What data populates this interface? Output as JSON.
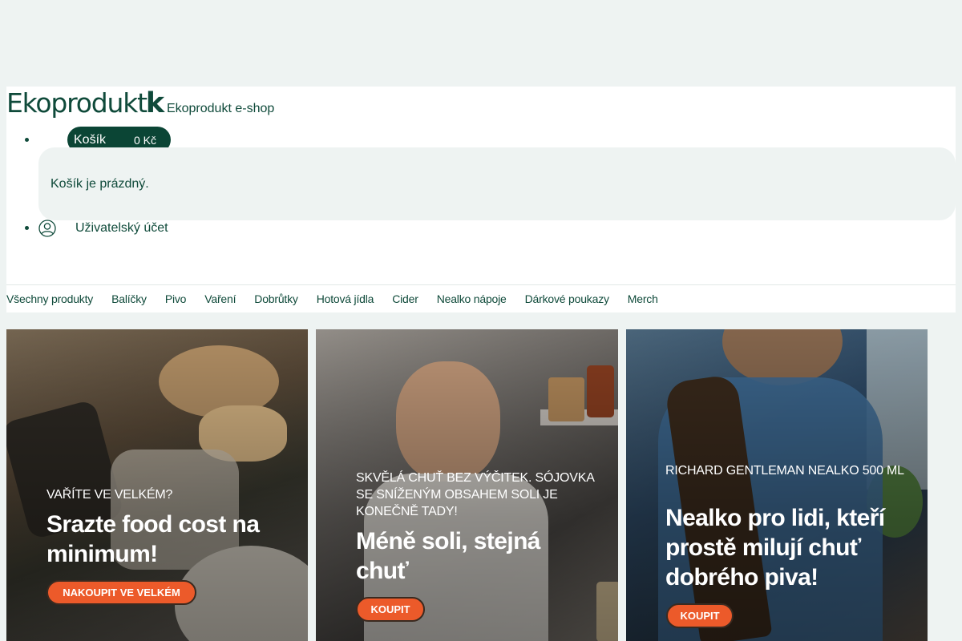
{
  "header": {
    "logo_text": "Ekoprodukt",
    "logo_mark": "k",
    "site_name": "Ekoprodukt e-shop",
    "cart": {
      "label": "Košík",
      "price": "0 Kč",
      "empty_message": "Košík je prázdný."
    },
    "account": {
      "icon": "user-icon",
      "label": "Uživatelský účet"
    }
  },
  "nav": {
    "items": [
      "Všechny produkty",
      "Balíčky",
      "Pivo",
      "Vaření",
      "Dobrůtky",
      "Hotová jídla",
      "Cider",
      "Nealko nápoje",
      "Dárkové poukazy",
      "Merch"
    ]
  },
  "banners": [
    {
      "kicker": "VAŘÍTE VE VELKÉM?",
      "headline": "Srazte food cost na minimum!",
      "cta": "NAKOUPIT VE VELKÉM"
    },
    {
      "kicker": "SKVĚLÁ CHUŤ BEZ VÝČITEK. SÓJOVKA SE SNÍŽENÝM OBSAHEM SOLI JE KONEČNĚ TADY!",
      "headline": "Méně soli, stejná chuť",
      "cta": "KOUPIT"
    },
    {
      "kicker": "RICHARD GENTLEMAN NEALKO 500 ML",
      "headline": "Nealko pro lidi, kteří prostě milují chuť dobrého piva!",
      "cta": "KOUPIT"
    }
  ],
  "colors": {
    "brand_green": "#0b4535",
    "accent_orange": "#ec5a2a",
    "page_bg": "#eef3f2"
  }
}
